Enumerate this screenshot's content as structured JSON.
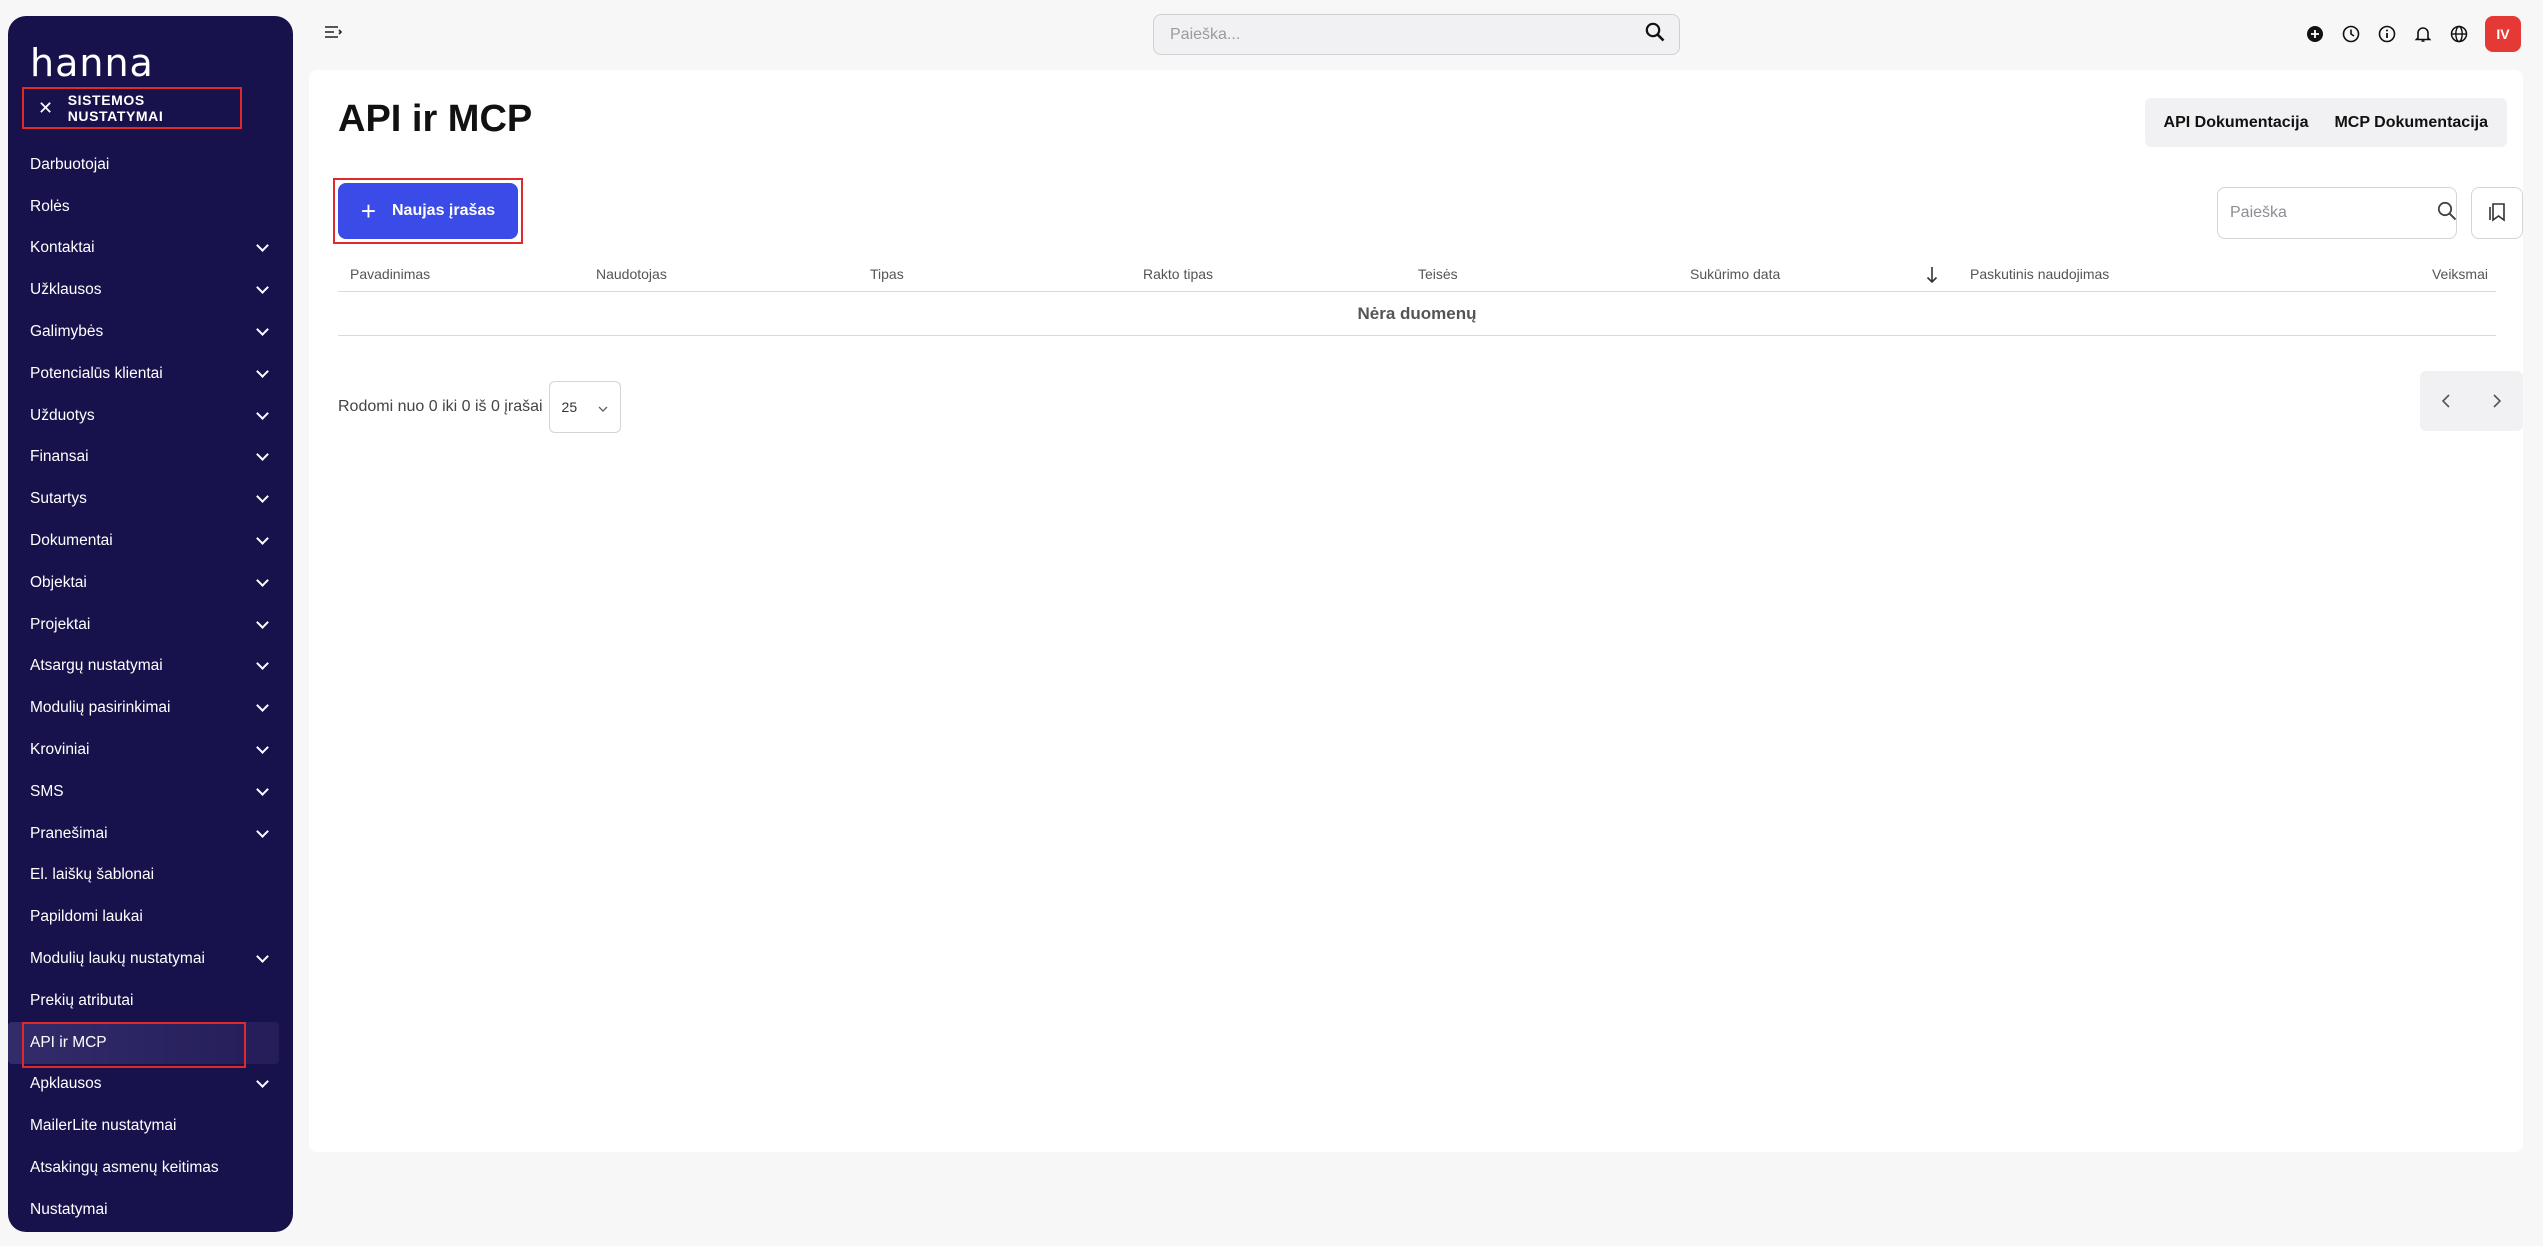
{
  "sidebar": {
    "logo": "hanna",
    "section_title": "SISTEMOS NUSTATYMAI",
    "items": [
      {
        "label": "Darbuotojai",
        "chevron": false
      },
      {
        "label": "Rolės",
        "chevron": false
      },
      {
        "label": "Kontaktai",
        "chevron": true
      },
      {
        "label": "Užklausos",
        "chevron": true
      },
      {
        "label": "Galimybės",
        "chevron": true
      },
      {
        "label": "Potencialūs klientai",
        "chevron": true
      },
      {
        "label": "Užduotys",
        "chevron": true
      },
      {
        "label": "Finansai",
        "chevron": true
      },
      {
        "label": "Sutartys",
        "chevron": true
      },
      {
        "label": "Dokumentai",
        "chevron": true
      },
      {
        "label": "Objektai",
        "chevron": true
      },
      {
        "label": "Projektai",
        "chevron": true
      },
      {
        "label": "Atsargų nustatymai",
        "chevron": true
      },
      {
        "label": "Modulių pasirinkimai",
        "chevron": true
      },
      {
        "label": "Kroviniai",
        "chevron": true
      },
      {
        "label": "SMS",
        "chevron": true
      },
      {
        "label": "Pranešimai",
        "chevron": true
      },
      {
        "label": "El. laiškų šablonai",
        "chevron": false
      },
      {
        "label": "Papildomi laukai",
        "chevron": false
      },
      {
        "label": "Modulių laukų nustatymai",
        "chevron": true
      },
      {
        "label": "Prekių atributai",
        "chevron": false
      },
      {
        "label": "API ir MCP",
        "chevron": false,
        "active": true
      },
      {
        "label": "Apklausos",
        "chevron": true
      },
      {
        "label": "MailerLite nustatymai",
        "chevron": false
      },
      {
        "label": "Atsakingų asmenų keitimas",
        "chevron": false
      },
      {
        "label": "Nustatymai",
        "chevron": false
      }
    ]
  },
  "topbar": {
    "search_placeholder": "Paieška...",
    "avatar_initials": "IV",
    "icons": [
      "plus-circle-icon",
      "clock-icon",
      "info-icon",
      "bell-icon",
      "globe-icon"
    ]
  },
  "main": {
    "title": "API ir MCP",
    "api_docs_label": "API Dokumentacija",
    "mcp_docs_label": "MCP Dokumentacija",
    "new_button_label": "Naujas įrašas",
    "table_search_placeholder": "Paieška",
    "columns": [
      "Pavadinimas",
      "Naudotojas",
      "Tipas",
      "Rakto tipas",
      "Teisės",
      "Sukūrimo data",
      "Paskutinis naudojimas",
      "Veiksmai"
    ],
    "empty_text": "Nėra duomenų",
    "footer_text": "Rodomi nuo 0 iki 0 iš 0 įrašai",
    "page_size": "25"
  },
  "colors": {
    "sidebar_bg": "#17124b",
    "accent": "#3b4be8",
    "avatar_bg": "#e53935",
    "highlight_border": "#e0292b"
  }
}
